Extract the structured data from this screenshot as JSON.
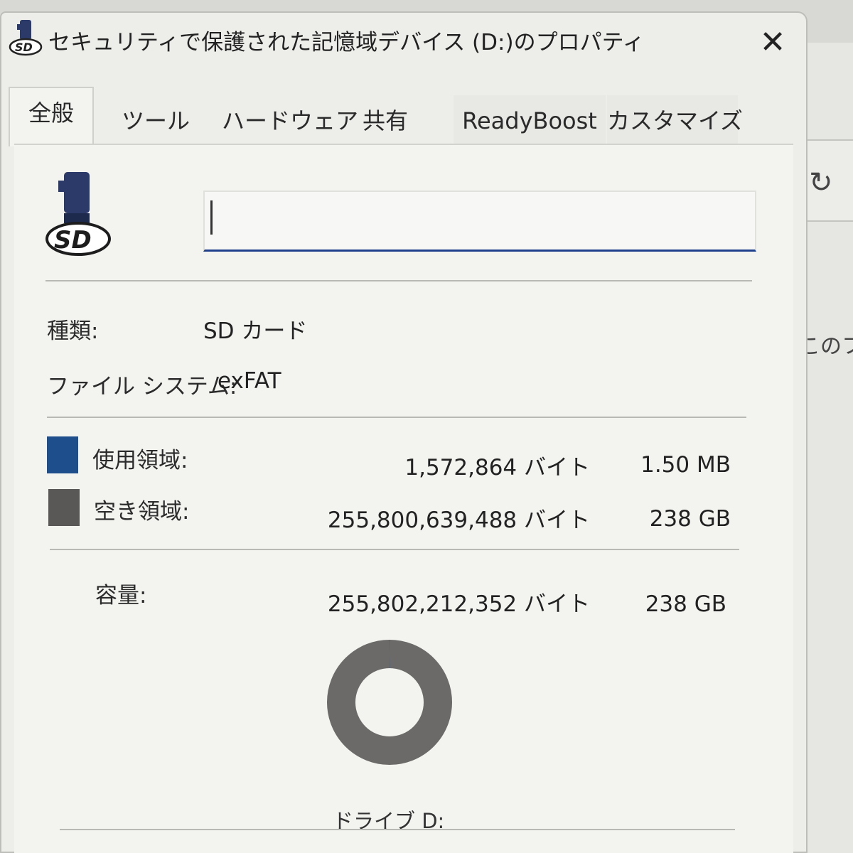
{
  "window": {
    "title": "セキュリティで保護された記憶域デバイス (D:)のプロパティ",
    "close_glyph": "✕"
  },
  "tabs": [
    {
      "label": "全般",
      "active": true
    },
    {
      "label": "ツール",
      "active": false
    },
    {
      "label": "ハードウェア",
      "active": false
    },
    {
      "label": "共有",
      "active": false
    },
    {
      "label": "ReadyBoost",
      "active": false
    },
    {
      "label": "カスタマイズ",
      "active": false
    }
  ],
  "general": {
    "drive_icon": "sd-card-drive-icon",
    "volume_name_value": "",
    "type_label": "種類:",
    "type_value": "SD カード",
    "fs_label": "ファイル システム:",
    "fs_value": "exFAT",
    "used": {
      "label": "使用領域:",
      "bytes": "1,572,864 バイト",
      "size": "1.50 MB",
      "color": "#1f4e8c"
    },
    "free": {
      "label": "空き領域:",
      "bytes": "255,800,639,488 バイト",
      "size": "238 GB",
      "color": "#5a5856"
    },
    "capacity": {
      "label": "容量:",
      "bytes": "255,802,212,352 バイト",
      "size": "238 GB"
    },
    "used_fraction": 6.15e-06,
    "drive_label": "ドライブ D:"
  },
  "background": {
    "partial_text": "このフ",
    "refresh_icon": "refresh-icon"
  },
  "colors": {
    "accent": "#1e3f8c",
    "used": "#1f4e8c",
    "free": "#5a5856",
    "donut": "#6b6a68"
  }
}
